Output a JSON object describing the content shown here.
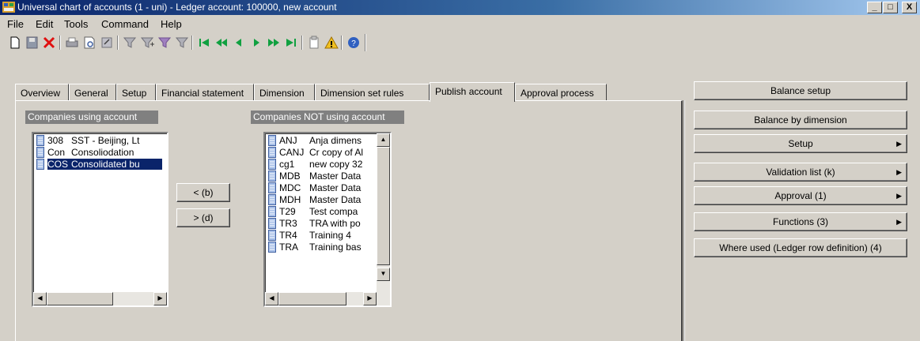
{
  "window": {
    "title": "Universal chart of accounts (1 - uni) - Ledger account: 100000, new account",
    "minimize": "_",
    "maximize": "□",
    "close": "X"
  },
  "menu": [
    "File",
    "Edit",
    "Tools",
    "Command",
    "Help"
  ],
  "toolbar": {
    "icons": [
      "new-icon",
      "save-icon",
      "delete-icon",
      "print-icon",
      "print-preview-icon",
      "export-icon",
      "filter-icon",
      "filter-add-icon",
      "filter-apply-icon",
      "filter-clear-icon",
      "first-record-icon",
      "previous-page-icon",
      "previous-record-icon",
      "next-record-icon",
      "next-page-icon",
      "last-record-icon",
      "notes-icon",
      "alert-icon",
      "help-icon"
    ]
  },
  "tabs": [
    "Overview",
    "General",
    "Setup",
    "Financial statement",
    "Dimension",
    "Dimension set rules",
    "Publish account",
    "Approval process"
  ],
  "active_tab": "Publish account",
  "using": {
    "header": "Companies using account",
    "rows": [
      {
        "code": "308",
        "desc": "SST - Beijing, Lt"
      },
      {
        "code": "Con",
        "desc": "Consoliodation"
      },
      {
        "code": "COS",
        "desc": "Consolidated bu"
      }
    ],
    "selected_index": 2
  },
  "move_buttons": {
    "remove": "< (b)",
    "add": "> (d)"
  },
  "not_using": {
    "header": "Companies NOT using account",
    "rows": [
      {
        "code": "ANJ",
        "desc": "Anja dimens"
      },
      {
        "code": "CANJ",
        "desc": "Cr copy of Al"
      },
      {
        "code": "cg1",
        "desc": "new copy 32"
      },
      {
        "code": "MDB",
        "desc": "Master Data"
      },
      {
        "code": "MDC",
        "desc": "Master Data"
      },
      {
        "code": "MDH",
        "desc": "Master Data"
      },
      {
        "code": "T29",
        "desc": "Test compa"
      },
      {
        "code": "TR3",
        "desc": "TRA with po"
      },
      {
        "code": "TR4",
        "desc": "Training 4"
      },
      {
        "code": "TRA",
        "desc": "Training bas"
      }
    ]
  },
  "side_buttons": [
    {
      "label": "Balance setup",
      "submenu": false
    },
    {
      "label": "Balance by dimension",
      "submenu": false
    },
    {
      "label": "Setup",
      "submenu": true
    },
    {
      "label": "Validation list (k)",
      "submenu": true
    },
    {
      "label": "Approval (1)",
      "submenu": true
    },
    {
      "label": "Functions (3)",
      "submenu": true
    },
    {
      "label": "Where used (Ledger row definition) (4)",
      "submenu": false
    }
  ],
  "colors": {
    "title_bar": "#0a246a",
    "selection": "#0a246a",
    "group_header": "#808080",
    "face": "#d4d0c8"
  }
}
